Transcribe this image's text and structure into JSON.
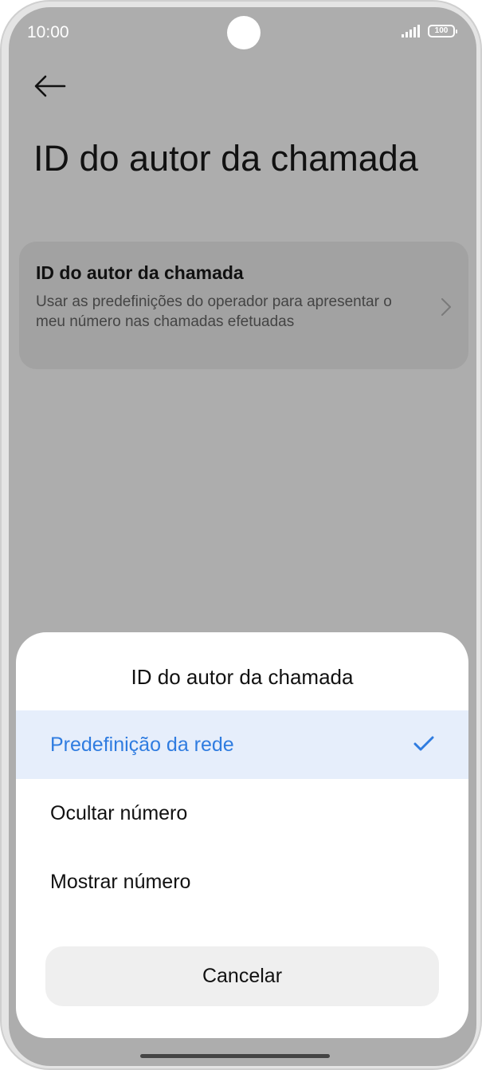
{
  "status_bar": {
    "time": "10:00",
    "battery": "100"
  },
  "page": {
    "title": "ID do autor da chamada"
  },
  "setting_card": {
    "title": "ID do autor da chamada",
    "subtitle": "Usar as predefinições do operador para apresentar o meu número nas chamadas efetuadas"
  },
  "dialog": {
    "title": "ID do autor da chamada",
    "options": [
      {
        "label": "Predefinição da rede",
        "selected": true
      },
      {
        "label": "Ocultar número",
        "selected": false
      },
      {
        "label": "Mostrar número",
        "selected": false
      }
    ],
    "cancel_label": "Cancelar"
  },
  "colors": {
    "accent": "#2f7ce0",
    "selected_bg": "#e6eefb",
    "scrim": "#adadad"
  }
}
